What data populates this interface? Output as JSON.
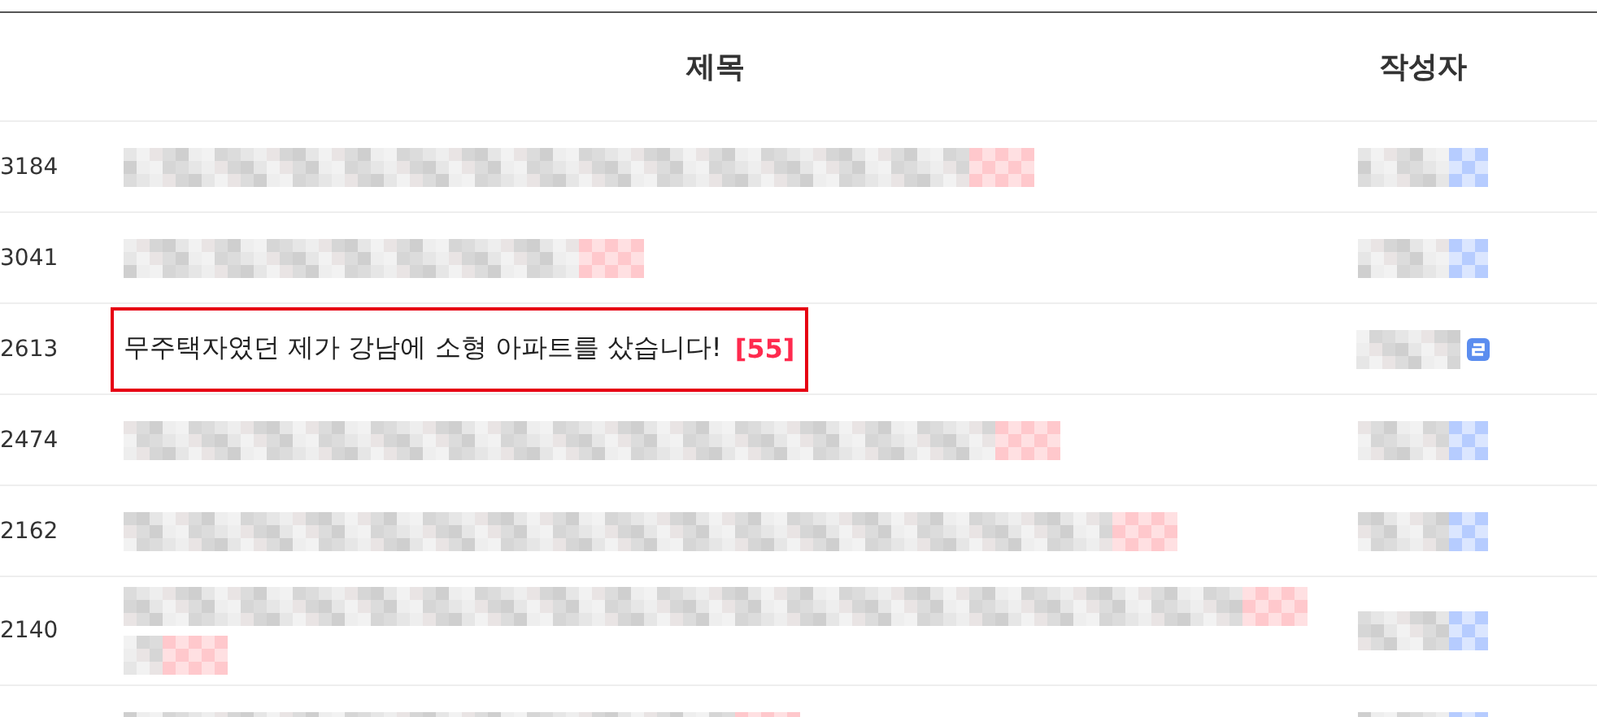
{
  "header": {
    "title": "제목",
    "author": "작성자"
  },
  "rows": [
    {
      "number": "3184",
      "kind": "blurred",
      "highlighted": false
    },
    {
      "number": "3041",
      "kind": "blurred",
      "highlighted": false
    },
    {
      "number": "2613",
      "kind": "text",
      "title": "무주택자였던 제가 강남에 소형 아파트를 샀습니다!",
      "comment_count": "[55]",
      "highlighted": true
    },
    {
      "number": "2474",
      "kind": "blurred",
      "highlighted": false
    },
    {
      "number": "2162",
      "kind": "blurred",
      "highlighted": false
    },
    {
      "number": "2140",
      "kind": "blurred",
      "highlighted": false
    },
    {
      "kind": "blurred",
      "highlighted": false
    }
  ]
}
